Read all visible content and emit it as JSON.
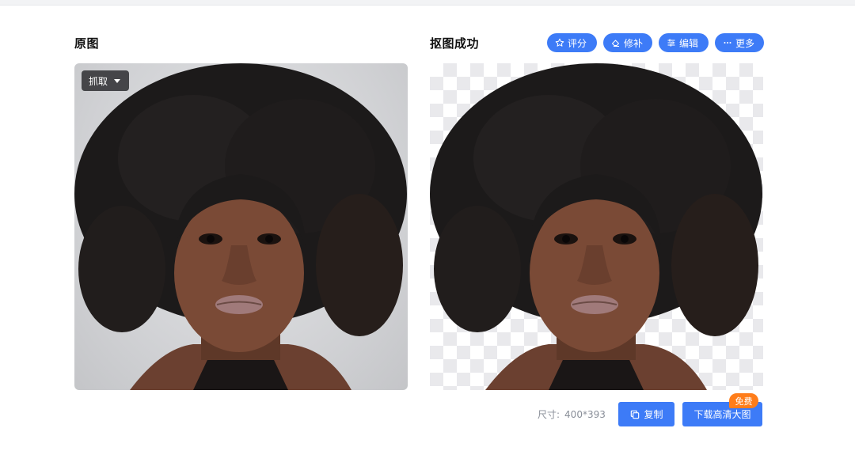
{
  "panels": {
    "original_title": "原图",
    "result_title": "抠图成功"
  },
  "actions": [
    {
      "label": "评分",
      "icon": "star-icon"
    },
    {
      "label": "修补",
      "icon": "eraser-icon"
    },
    {
      "label": "编辑",
      "icon": "sliders-icon"
    },
    {
      "label": "更多",
      "icon": "more-icon"
    }
  ],
  "original": {
    "grab_label": "抓取"
  },
  "result": {
    "size_label": "尺寸:",
    "size_value": "400*393",
    "copy_label": "复制",
    "download_label": "下载高清大图",
    "free_badge": "免费"
  },
  "colors": {
    "primary": "#3d7bf7",
    "badge": "#ff7d1a"
  }
}
